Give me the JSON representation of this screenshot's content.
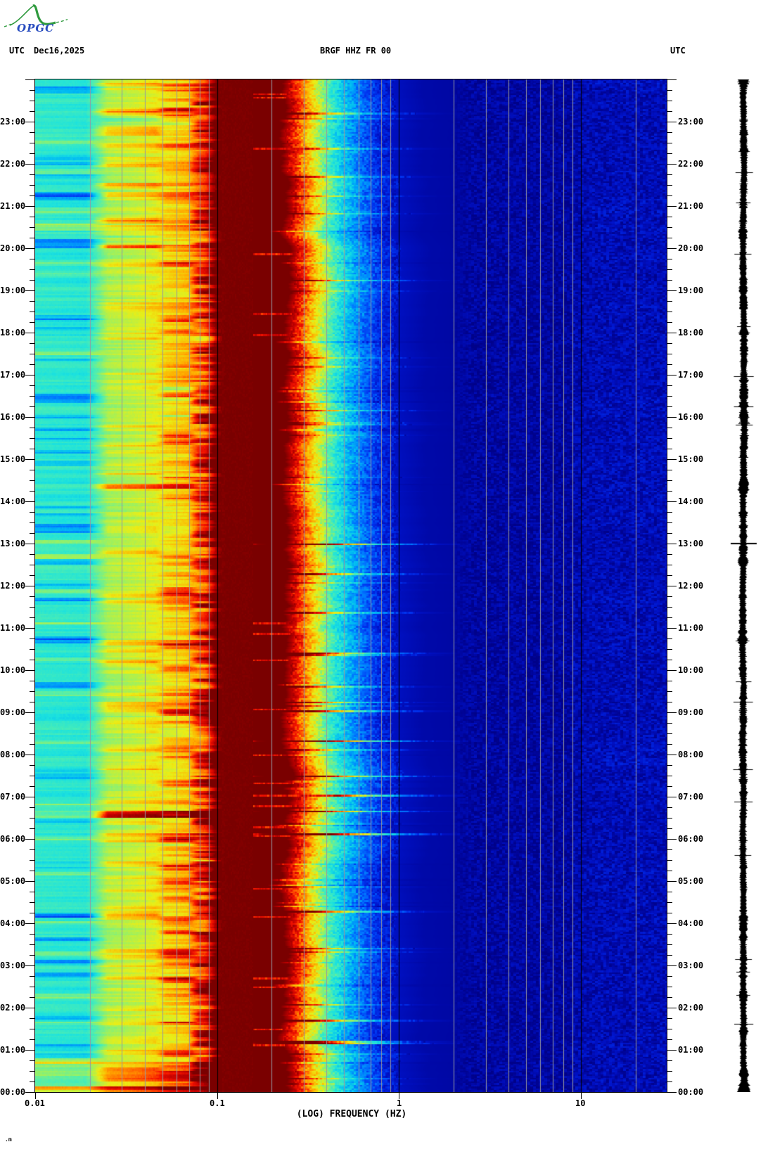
{
  "header": {
    "utc_label_left": "UTC",
    "date": "Dec16,2025",
    "title": "BRGF HHZ FR 00",
    "utc_label_right": "UTC",
    "logo_text": "OPGC"
  },
  "footer_mark": ".m",
  "chart_data": {
    "type": "heatmap",
    "subtype": "seismic-spectrogram-with-helicorder-trace",
    "title": "BRGF HHZ FR 00",
    "date_utc": "Dec16,2025",
    "xlabel": "(LOG) FREQUENCY (HZ)",
    "x_scale": "log",
    "x_range_hz": [
      0.01,
      30
    ],
    "x_major_ticks": [
      {
        "hz": 0.01,
        "label": "0.01"
      },
      {
        "hz": 0.1,
        "label": "0.1"
      },
      {
        "hz": 1,
        "label": "1"
      },
      {
        "hz": 10,
        "label": "10"
      }
    ],
    "x_minor_gridlines_hz": [
      0.02,
      0.03,
      0.04,
      0.05,
      0.06,
      0.07,
      0.08,
      0.09,
      0.2,
      0.3,
      0.4,
      0.5,
      0.6,
      0.7,
      0.8,
      0.9,
      2,
      3,
      4,
      5,
      6,
      7,
      8,
      9,
      20
    ],
    "y_axis": {
      "unit": "UTC time of day, midnight at bottom",
      "hour_labels_top_to_bottom": [
        "23:00",
        "22:00",
        "21:00",
        "20:00",
        "19:00",
        "18:00",
        "17:00",
        "16:00",
        "15:00",
        "14:00",
        "13:00",
        "12:00",
        "11:00",
        "10:00",
        "09:00",
        "08:00",
        "07:00",
        "06:00",
        "05:00",
        "04:00",
        "03:00",
        "02:00",
        "01:00",
        "00:00"
      ],
      "minor_tick_minutes": 15
    },
    "gridline_color": "#97979f",
    "major_gridline_color": "#000000",
    "colormap_stops": [
      [
        0.0,
        "#000080"
      ],
      [
        0.04,
        "#000498"
      ],
      [
        0.1,
        "#0012c8"
      ],
      [
        0.18,
        "#0034f0"
      ],
      [
        0.26,
        "#0074ff"
      ],
      [
        0.34,
        "#00b8f4"
      ],
      [
        0.42,
        "#1ce2de"
      ],
      [
        0.5,
        "#50eeb0"
      ],
      [
        0.58,
        "#a0f05c"
      ],
      [
        0.66,
        "#eaee16"
      ],
      [
        0.74,
        "#ffae00"
      ],
      [
        0.8,
        "#ff6400"
      ],
      [
        0.86,
        "#f51400"
      ],
      [
        0.93,
        "#bc0000"
      ],
      [
        1.0,
        "#7a0000"
      ]
    ],
    "mean_spectrum_log10hz_to_level": [
      [
        -2.0,
        0.455
      ],
      [
        -1.72,
        0.44
      ],
      [
        -1.6,
        0.59
      ],
      [
        -1.45,
        0.62
      ],
      [
        -1.3,
        0.665
      ],
      [
        -1.16,
        0.71
      ],
      [
        -1.06,
        0.8
      ],
      [
        -1.0,
        0.985
      ],
      [
        -0.95,
        1.0
      ],
      [
        -0.62,
        1.0
      ],
      [
        -0.55,
        0.86
      ],
      [
        -0.47,
        0.7
      ],
      [
        -0.43,
        0.63
      ],
      [
        -0.39,
        0.53
      ],
      [
        -0.34,
        0.44
      ],
      [
        -0.26,
        0.33
      ],
      [
        -0.18,
        0.24
      ],
      [
        -0.09,
        0.15
      ],
      [
        0.0,
        0.09
      ],
      [
        0.15,
        0.062
      ],
      [
        0.35,
        0.054
      ],
      [
        1.0,
        0.052
      ],
      [
        1.2,
        0.058
      ],
      [
        1.47,
        0.06
      ]
    ],
    "saturated_band_hz": [
      0.1,
      0.28
    ],
    "row_noise": {
      "bands": [
        {
          "name": "0.01-0.025Hz",
          "amp": 0.045,
          "p_up": 0.06,
          "up": [
            0.06,
            0.15
          ],
          "p_dn": 0.05,
          "dn": [
            0.1,
            0.22
          ]
        },
        {
          "name": "0.025-0.05Hz",
          "amp": 0.05,
          "p_up": 0.1,
          "up": [
            0.05,
            0.13
          ],
          "p_dn": 0.03,
          "dn": [
            0.05,
            0.08
          ]
        },
        {
          "name": "0.05-0.07Hz",
          "amp": 0.06,
          "p_up": 0.16,
          "up": [
            0.06,
            0.16
          ],
          "p_dn": 0.05,
          "dn": [
            0.04,
            0.1
          ]
        },
        {
          "name": "0.07-0.1Hz",
          "amp": 0.1,
          "p_up": 0.28,
          "up": [
            0.06,
            0.2
          ],
          "p_dn": 0.08,
          "dn": [
            0.05,
            0.12
          ]
        }
      ],
      "common_boost": {
        "p": 0.05,
        "range": [
          0.05,
          0.12
        ]
      },
      "plateau_bright_row_p": 0.03,
      "edge": {
        "base_log10hz": -0.62,
        "wander": 0.05,
        "spike_p": 0.07,
        "spike": [
          0.04,
          0.26
        ]
      },
      "right": {
        "mottle": 0.045,
        "streak": 0.05
      }
    },
    "events": [
      {
        "t": [
          0.0,
          0.1
        ],
        "band": "low_all",
        "delta": 0.25
      },
      {
        "t": [
          0.05,
          0.7
        ],
        "band": "low_all",
        "delta": 0.11
      },
      {
        "t": [
          0.25,
          0.5
        ],
        "band": "mid",
        "delta": 0.1
      },
      {
        "t": [
          6.5,
          6.63
        ],
        "band": "mid",
        "delta": 0.3
      },
      {
        "t": [
          6.5,
          6.63
        ],
        "band": "cyan",
        "delta": 0.07
      },
      {
        "t": [
          20.42,
          20.58
        ],
        "band": "cyan",
        "delta": 0.11
      },
      {
        "t": [
          23.68,
          23.8
        ],
        "band": "cyan",
        "delta": -0.13
      },
      {
        "t": [
          22.12,
          22.22
        ],
        "band": "cyan",
        "delta": -0.12
      },
      {
        "t": [
          21.2,
          21.32
        ],
        "band": "cyan",
        "delta": -0.13
      },
      {
        "t": [
          20.03,
          20.18
        ],
        "band": "cyan",
        "delta": -0.16
      },
      {
        "t": [
          18.32,
          18.4
        ],
        "band": "cyan",
        "delta": -0.1
      },
      {
        "t": [
          16.35,
          16.45
        ],
        "band": "cyan",
        "delta": -0.12
      },
      {
        "t": [
          14.85,
          14.93
        ],
        "band": "cyan",
        "delta": -0.11
      },
      {
        "t": [
          13.28,
          13.43
        ],
        "band": "cyan",
        "delta": -0.15
      },
      {
        "t": [
          12.53,
          12.62
        ],
        "band": "cyan",
        "delta": -0.11
      },
      {
        "t": [
          10.63,
          10.73
        ],
        "band": "cyan",
        "delta": -0.12
      },
      {
        "t": [
          9.52,
          9.68
        ],
        "band": "cyan",
        "delta": -0.13
      },
      {
        "t": [
          7.43,
          7.52
        ],
        "band": "cyan",
        "delta": -0.11
      },
      {
        "t": [
          5.33,
          5.43
        ],
        "band": "cyan",
        "delta": -0.12
      },
      {
        "t": [
          4.13,
          4.22
        ],
        "band": "cyan",
        "delta": -0.11
      },
      {
        "t": [
          2.73,
          2.83
        ],
        "band": "cyan",
        "delta": -0.12
      },
      {
        "t": [
          1.68,
          1.78
        ],
        "band": "cyan",
        "delta": -0.11
      }
    ],
    "seismogram": {
      "pen_color": "#000000",
      "marker_time_label": "13:00"
    }
  }
}
